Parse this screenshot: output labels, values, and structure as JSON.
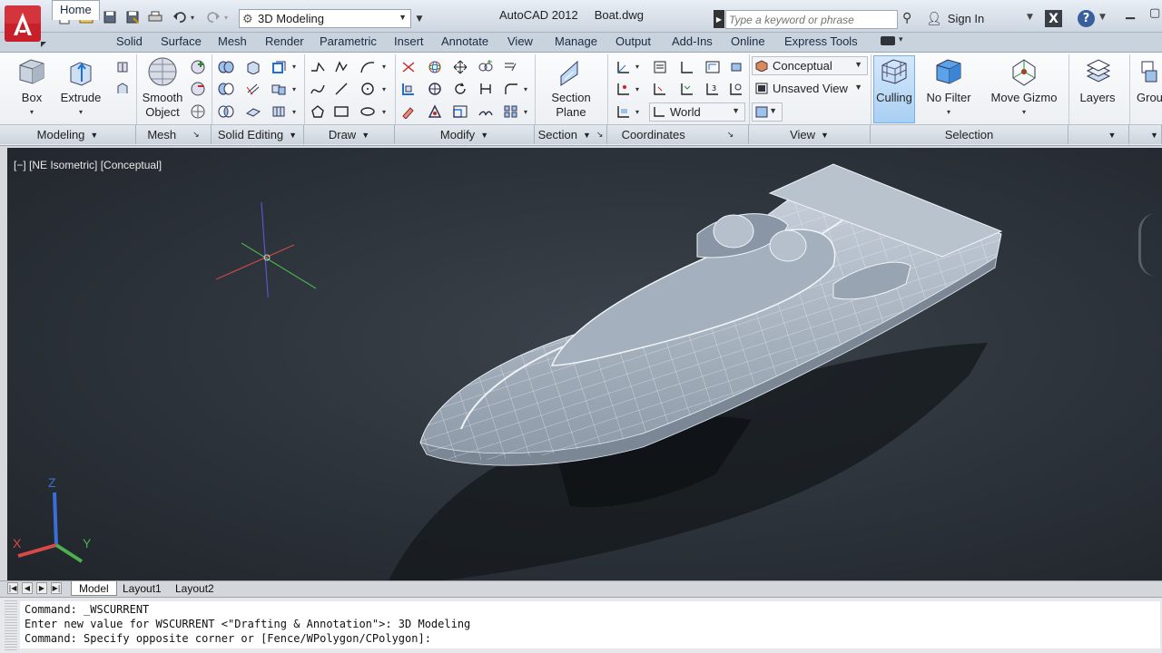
{
  "titlebar": {
    "app_name": "AutoCAD 2012",
    "file_name": "Boat.dwg",
    "workspace": "3D Modeling",
    "search_placeholder": "Type a keyword or phrase",
    "sign_in": "Sign In"
  },
  "ribbon_tabs": [
    "Home",
    "Solid",
    "Surface",
    "Mesh",
    "Render",
    "Parametric",
    "Insert",
    "Annotate",
    "View",
    "Manage",
    "Output",
    "Add-Ins",
    "Online",
    "Express Tools"
  ],
  "panels": {
    "modeling": {
      "title": "Modeling",
      "box": "Box",
      "extrude": "Extrude"
    },
    "mesh": {
      "title": "Mesh",
      "smooth_object_l1": "Smooth",
      "smooth_object_l2": "Object"
    },
    "solid_editing": {
      "title": "Solid Editing"
    },
    "draw": {
      "title": "Draw"
    },
    "modify": {
      "title": "Modify"
    },
    "section": {
      "title": "Section",
      "section_plane_l1": "Section",
      "section_plane_l2": "Plane"
    },
    "coordinates": {
      "title": "Coordinates",
      "ucs": "World"
    },
    "view": {
      "title": "View",
      "visual_style": "Conceptual",
      "named_view": "Unsaved View"
    },
    "selection": {
      "title": "Selection",
      "culling": "Culling",
      "no_filter": "No Filter",
      "move_gizmo": "Move Gizmo"
    },
    "layers": {
      "title": "Layers"
    },
    "groups": {
      "title": "Grou"
    }
  },
  "viewport": {
    "label": "[−] [NE Isometric] [Conceptual]",
    "axis_x": "X",
    "axis_y": "Y",
    "axis_z": "Z"
  },
  "layout_tabs": [
    "Model",
    "Layout1",
    "Layout2"
  ],
  "command_lines": [
    "Command: _WSCURRENT",
    "Enter new value for WSCURRENT <\"Drafting & Annotation\">: 3D Modeling",
    "Command: Specify opposite corner or [Fence/WPolygon/CPolygon]:"
  ],
  "colors": {
    "ribbon_accent": "#a9cff3",
    "viewport_bg": "#2c3239",
    "logo_red": "#c8202a"
  }
}
